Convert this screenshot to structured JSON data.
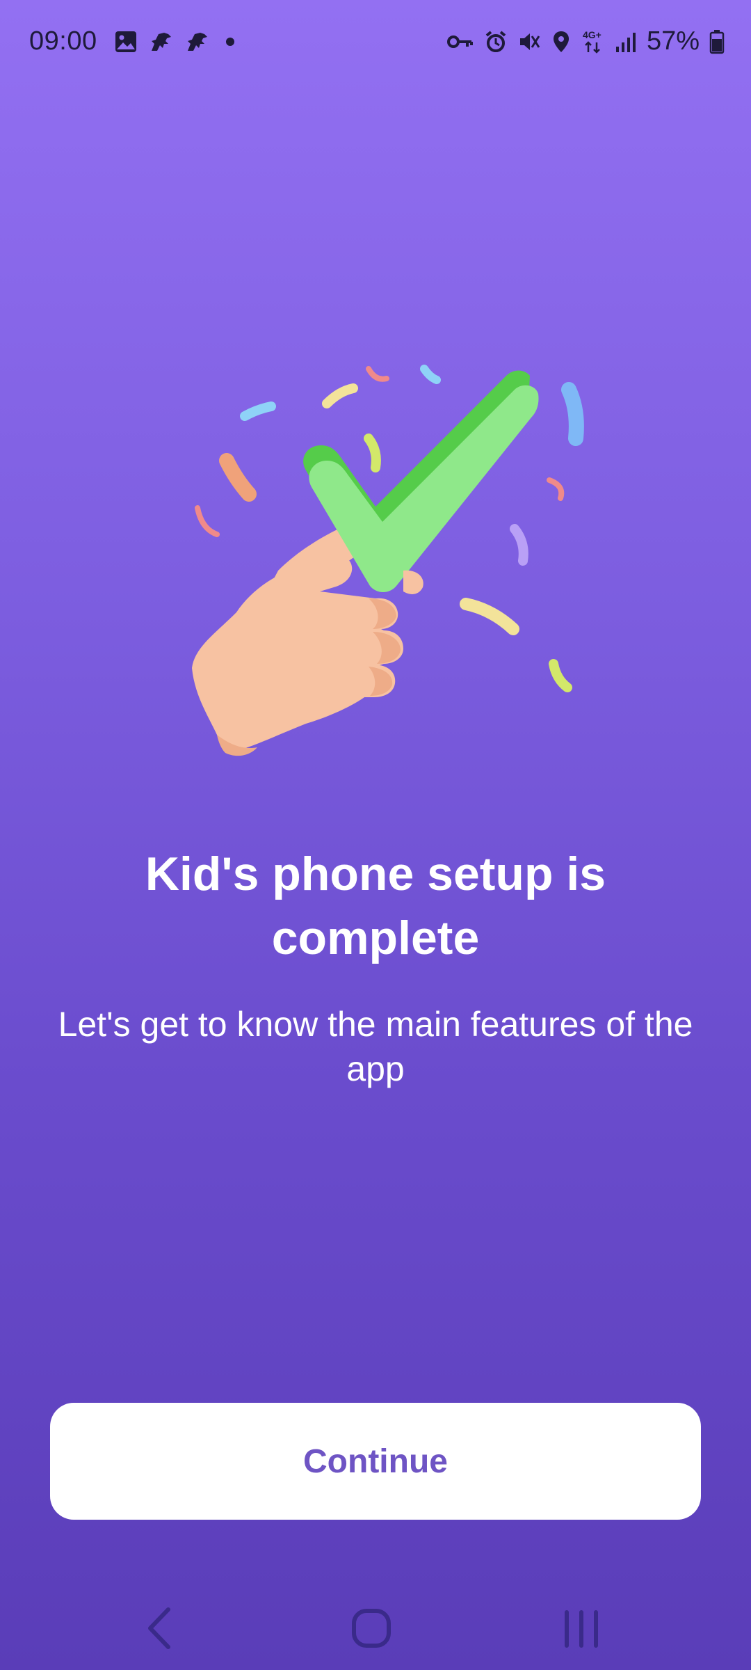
{
  "status_bar": {
    "time": "09:00",
    "battery_percent": "57%",
    "left_icons": [
      "gallery-icon",
      "dino-icon",
      "dino-icon",
      "notification-dot-icon"
    ],
    "right_icons": [
      "vpn-key-icon",
      "alarm-icon",
      "mute-icon",
      "location-icon",
      "network-4g-icon",
      "signal-icon",
      "battery-icon"
    ]
  },
  "illustration": {
    "icon": "hand-holding-checkmark-icon"
  },
  "content": {
    "title": "Kid's phone setup is complete",
    "subtitle": "Let's get to know the main features of the app"
  },
  "actions": {
    "continue_label": "Continue"
  },
  "nav_bar": {
    "icons": [
      "back-icon",
      "home-icon",
      "recents-icon"
    ]
  },
  "colors": {
    "background_top": "#9370f2",
    "background_bottom": "#5a3db8",
    "button_bg": "#ffffff",
    "button_text": "#6e54c4",
    "check_light": "#8fe88a",
    "check_dark": "#55cc4a",
    "skin": "#f7c2a2"
  }
}
